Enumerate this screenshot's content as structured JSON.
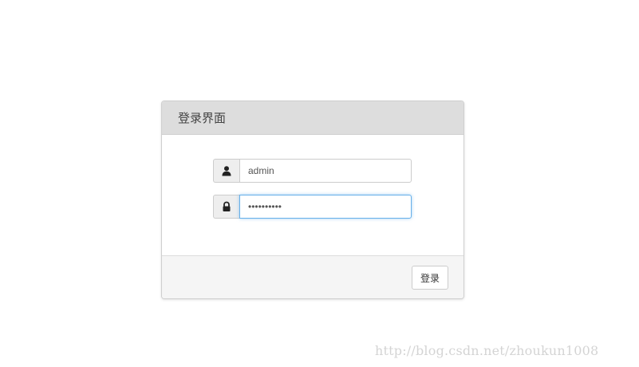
{
  "panel": {
    "title": "登录界面"
  },
  "form": {
    "username": {
      "icon": "user-icon",
      "value": "admin"
    },
    "password": {
      "icon": "lock-icon",
      "value": "••••••••••"
    },
    "submit_label": "登录"
  },
  "watermark": "http://blog.csdn.net/zhoukun1008",
  "colors": {
    "heading_bg": "#dddddd",
    "footer_bg": "#f5f5f5",
    "focus_border": "#66afe9",
    "addon_bg": "#eeeeee"
  }
}
